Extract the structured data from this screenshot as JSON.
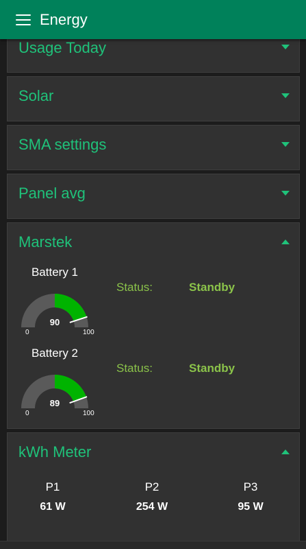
{
  "appbar": {
    "title": "Energy",
    "color": "#00815a"
  },
  "sections": {
    "usage_today": "Usage Today",
    "solar": "Solar",
    "sma_settings": "SMA settings",
    "panel_avg": "Panel avg",
    "marstek": "Marstek",
    "kwh_meter": "kWh Meter"
  },
  "marstek": {
    "batteries": [
      {
        "name": "Battery 1",
        "value": "90",
        "min": "0",
        "max": "100",
        "level": 90,
        "status_label": "Status:",
        "status": "Standby"
      },
      {
        "name": "Battery 2",
        "value": "89",
        "min": "0",
        "max": "100",
        "level": 89,
        "status_label": "Status:",
        "status": "Standby"
      }
    ]
  },
  "kwh_meter": {
    "phases": [
      {
        "name": "P1",
        "value": "61 W"
      },
      {
        "name": "P2",
        "value": "254 W"
      },
      {
        "name": "P3",
        "value": "95 W"
      }
    ]
  },
  "colors": {
    "accent": "#1fc27a",
    "status": "#8bc34a",
    "gauge_fill": "#00b300",
    "gauge_track": "#5a5a5a",
    "phase_needle": "#ff8c1a"
  }
}
